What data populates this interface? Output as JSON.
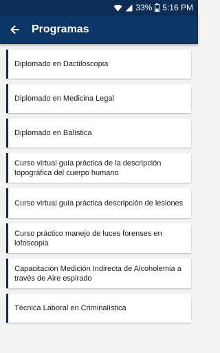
{
  "status_bar": {
    "battery": "33%",
    "time": "5:16 PM"
  },
  "header": {
    "title": "Programas"
  },
  "programs": [
    {
      "label": "Diplomado en Dactiloscopia"
    },
    {
      "label": "Diplomado en Medicina Legal"
    },
    {
      "label": "Diplomado en Balística"
    },
    {
      "label": "Curso virtual guía práctica de la descripción topográfica del cuerpo humano"
    },
    {
      "label": "Curso virtual guía práctica descripción de lesiones"
    },
    {
      "label": "Curso práctico manejo de luces forenses en lofoscopia"
    },
    {
      "label": "Capacitación Medición Indirecta de Alcoholemia a través de Aire espirado"
    },
    {
      "label": "Técnica Laboral en Criminalística"
    }
  ],
  "colors": {
    "app_bar": "#0d3566",
    "card_accent": "#0d2a4f",
    "background": "#f2f2f2"
  }
}
